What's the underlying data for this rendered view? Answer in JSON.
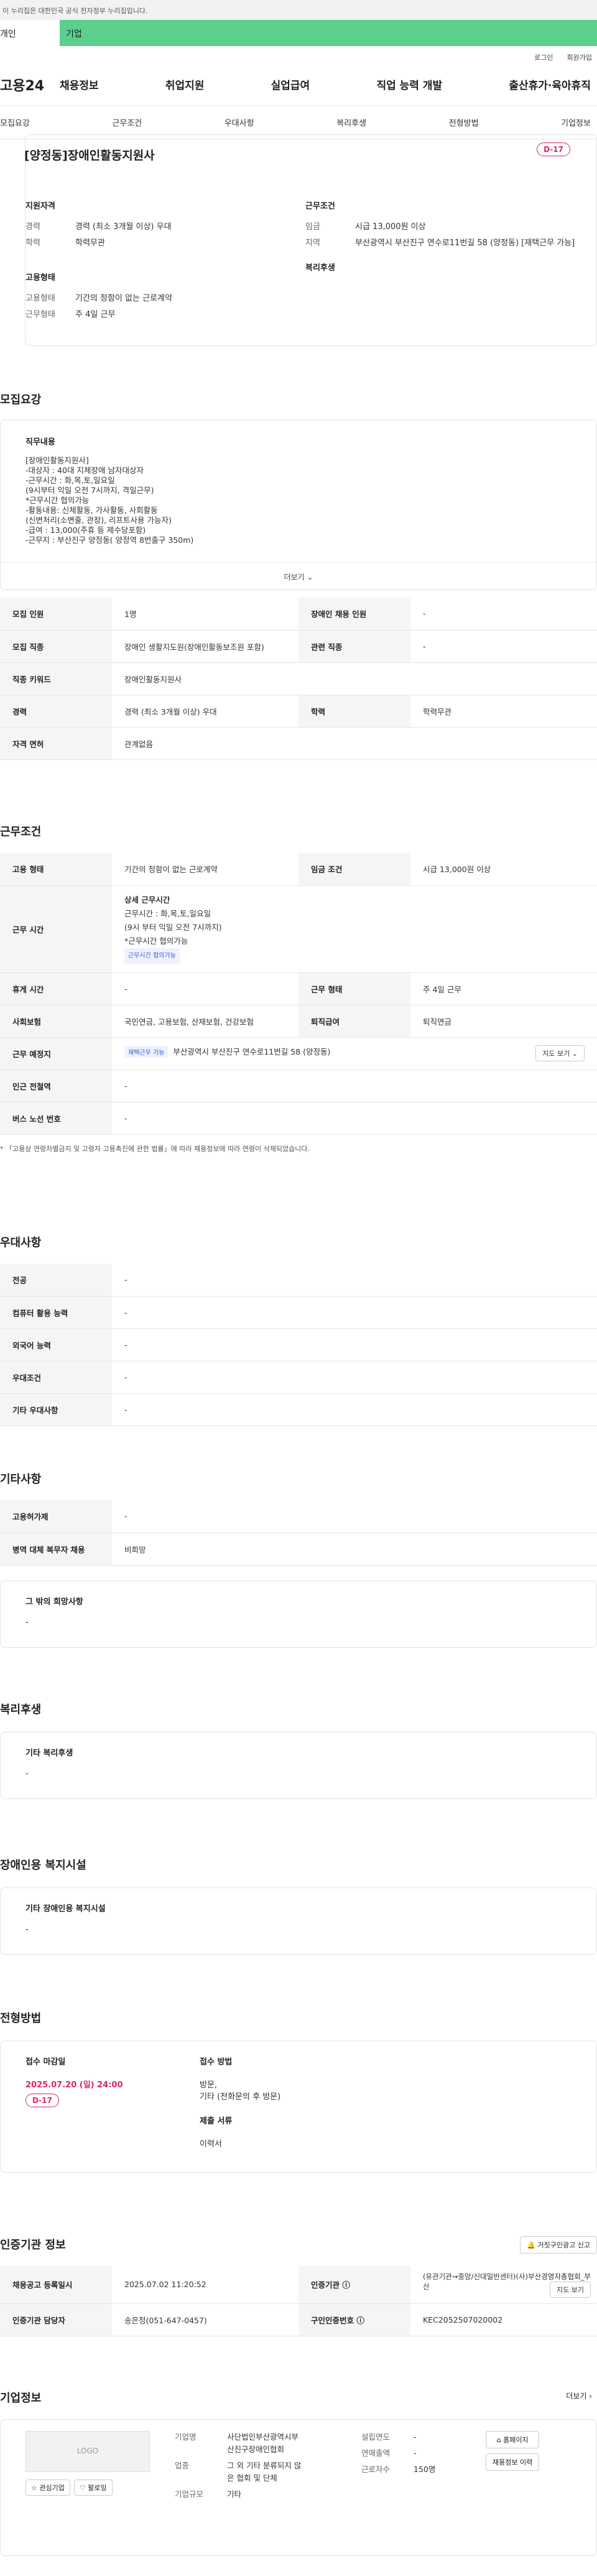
{
  "banner": "이 누리집은 대한민국 공식 전자정부 누리집입니다.",
  "topTabs": [
    "개인",
    "기업"
  ],
  "util": [
    "로그인",
    "회원가입"
  ],
  "logo": "고용24",
  "gnb": [
    "채용정보",
    "취업지원",
    "실업급여",
    "직업 능력 개발",
    "출산휴가·육아휴직"
  ],
  "subtabs": [
    "모집요강",
    "근무조건",
    "우대사항",
    "복리후생",
    "전형방법",
    "기업정보"
  ],
  "job": {
    "title": "[양정동]장애인활동지원사",
    "dday": "D-17",
    "qual_cap": "지원자격",
    "exp_k": "경력",
    "exp_v": "경력 (최소 3개월 이상) 우대",
    "edu_k": "학력",
    "edu_v": "학력무관",
    "cond_cap": "근무조건",
    "wage_k": "임금",
    "wage_v": "시급 13,000원 이상",
    "area_k": "지역",
    "area_v": "부산광역시 부산진구 연수로11번길 58 (양정동) [재택근무 가능]",
    "type_cap": "고용형태",
    "emp_k": "고용형태",
    "emp_v": "기간의 정함이 없는 근로계약",
    "work_k": "근무형태",
    "work_v": "주 4일 근무",
    "welfare_cap": "복리후생"
  },
  "recruit": {
    "title": "모집요강",
    "desc_cap": "직무내용",
    "desc": "[장애인활동지원사]\n-대상자 : 40대 지체장애 남자대상자\n-근무시간 : 화,목,토,일요일\n(9시부터 익일 오전 7시까지, 격일근무)\n*근무시간 협의가능\n-활동내용: 신체활동, 가사활동, 사회활동\n(신변처리(소변줄, 관장), 리프트사용 가능자)\n-급여 : 13,000(주휴 등 제수당포함)\n-근무지 : 부산진구 양정동( 양정역 8번출구 350m)",
    "more": "더보기",
    "rows": [
      [
        "모집 인원",
        "1명",
        "장애인 채용 인원",
        "-"
      ],
      [
        "모집 직종",
        "장애인 생활지도원(장애인활동보조원 포함)",
        "관련 직종",
        "-"
      ],
      [
        "직종 키워드",
        "장애인활동지원사",
        "",
        ""
      ],
      [
        "경력",
        "경력 (최소 3개월 이상) 우대",
        "학력",
        "학력무관"
      ],
      [
        "자격 면허",
        "관계없음",
        "",
        ""
      ]
    ]
  },
  "work": {
    "title": "근무조건",
    "r1": [
      "고용 형태",
      "기간의 정함이 없는 근로계약",
      "임금 조건",
      "시급 13,000원 이상"
    ],
    "time_k": "근무 시간",
    "time_cap": "상세 근무시간",
    "time_lines": [
      "근무시간 : 화,목,토,일요일",
      "(9시 부터 익일 오전 7시까지)",
      "*근무시간 협의가능"
    ],
    "time_tag": "근무시간 협의가능",
    "r3": [
      "휴게 시간",
      "-",
      "근무 형태",
      "주 4일 근무"
    ],
    "r4": [
      "사회보험",
      "국민연금, 고용보험, 산재보험, 건강보험",
      "퇴직급여",
      "퇴직연금"
    ],
    "place_k": "근무 예정지",
    "place_tag": "재택근무 가능",
    "place_v": "부산광역시 부산진구 연수로11번길 58 (양정동)",
    "map": "지도 보기",
    "r6": [
      "인근 전철역",
      "-"
    ],
    "r7": [
      "버스 노선 번호",
      "-"
    ],
    "note": "* 「고용상 연령차별금지 및 고령자 고용촉진에 관한 법률」에 따라 채용정보에 따라 연령이 삭제되었습니다."
  },
  "pref": {
    "title": "우대사항",
    "rows": [
      [
        "전공",
        "-"
      ],
      [
        "컴퓨터 활용 능력",
        "-"
      ],
      [
        "외국어 능력",
        "-"
      ],
      [
        "우대조건",
        "-"
      ],
      [
        "기타 우대사항",
        "-"
      ]
    ]
  },
  "etc": {
    "title": "기타사항",
    "rows": [
      [
        "고용허가제",
        "-"
      ],
      [
        "병역 대체 복무자 채용",
        "비희망"
      ]
    ],
    "hope_cap": "그 밖의 희망사항",
    "hope_v": "-"
  },
  "welfare": {
    "title": "복리후생",
    "cap": "기타 복리후생",
    "v": "-"
  },
  "facility": {
    "title": "장애인용 복지시설",
    "cap": "기타 장애인용 복지시설",
    "v": "-"
  },
  "apply": {
    "title": "전형방법",
    "dl_cap": "접수 마감일",
    "dl": "2025.07.20 (일) 24:00",
    "dday": "D-17",
    "m_cap": "접수 방법",
    "m_v": [
      "방문,",
      "기타 (전화문의 후 방문)"
    ],
    "doc_cap": "제출 서류",
    "doc_v": "이력서"
  },
  "cert": {
    "title": "인증기관 정보",
    "report": "거짓구인광고 신고",
    "r1": [
      "채용공고 등록일시",
      "2025.07.02 11:20:52",
      "인증기관",
      "(유관기관→중앙/신대일반센터)(사)부산경영자총협회_부산",
      "지도 보기"
    ],
    "r2": [
      "인증기관 담당자",
      "송은정(051-647-0457)",
      "구인인증번호",
      "KEC2052507020002"
    ]
  },
  "company": {
    "title": "기업정보",
    "more": "더보기",
    "logo": "LOGO",
    "b1": "관심기업",
    "b2": "팔로잉",
    "name_k": "기업명",
    "name_v": "사단법인부산광역시부산진구장애인협회",
    "ind_k": "업종",
    "ind_v": "그 외 기타 분류되지 않은 협회 및 단체",
    "size_k": "기업규모",
    "size_v": "기타",
    "est_k": "설립연도",
    "est_v": "-",
    "sales_k": "연매출액",
    "sales_v": "-",
    "emp_k": "근로자수",
    "emp_v": "150명",
    "home": "홈페이지",
    "list": "채용정보 이력"
  }
}
